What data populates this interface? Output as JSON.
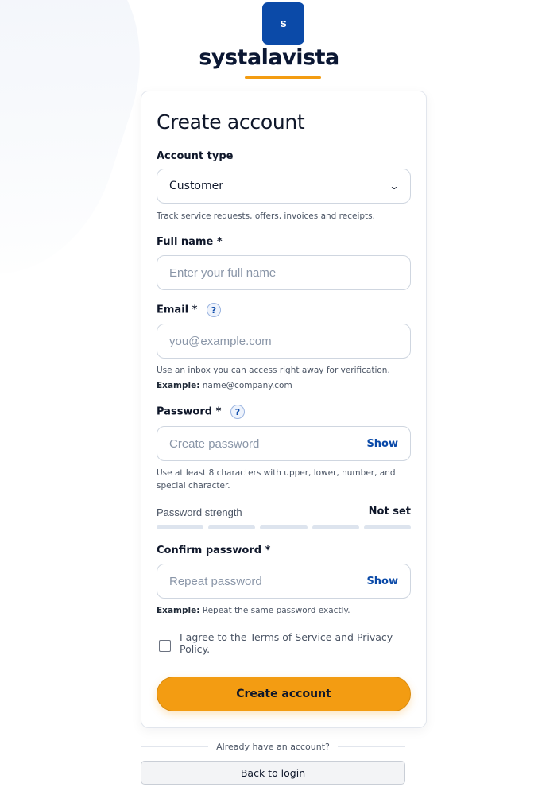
{
  "brand": {
    "mark_letter": "s",
    "name": "systalavista"
  },
  "colors": {
    "brand_blue": "#0b4aa8",
    "accent_orange": "#f39c12"
  },
  "form": {
    "title": "Create account",
    "account_type": {
      "label": "Account type",
      "selected": "Customer",
      "hint": "Track service requests, offers, invoices and receipts."
    },
    "full_name": {
      "label": "Full name *",
      "placeholder": "Enter your full name"
    },
    "email": {
      "label": "Email *",
      "placeholder": "you@example.com",
      "hint": "Use an inbox you can access right away for verification.",
      "example_label": "Example:",
      "example_value": "name@company.com"
    },
    "password": {
      "label": "Password *",
      "placeholder": "Create password",
      "show_label": "Show",
      "hint": "Use at least 8 characters with upper, lower, number, and special character."
    },
    "strength": {
      "label": "Password strength",
      "value": "Not set",
      "segments": 5,
      "filled": 0
    },
    "confirm_password": {
      "label": "Confirm password *",
      "placeholder": "Repeat password",
      "show_label": "Show",
      "example_label": "Example:",
      "example_value": "Repeat the same password exactly."
    },
    "agree_text": "I agree to the Terms of Service and Privacy Policy.",
    "submit_label": "Create account",
    "help_icon_glyph": "?",
    "select_chevron_glyph": "⌄"
  },
  "footer": {
    "divider_text": "Already have an account?",
    "back_label": "Back to login"
  }
}
